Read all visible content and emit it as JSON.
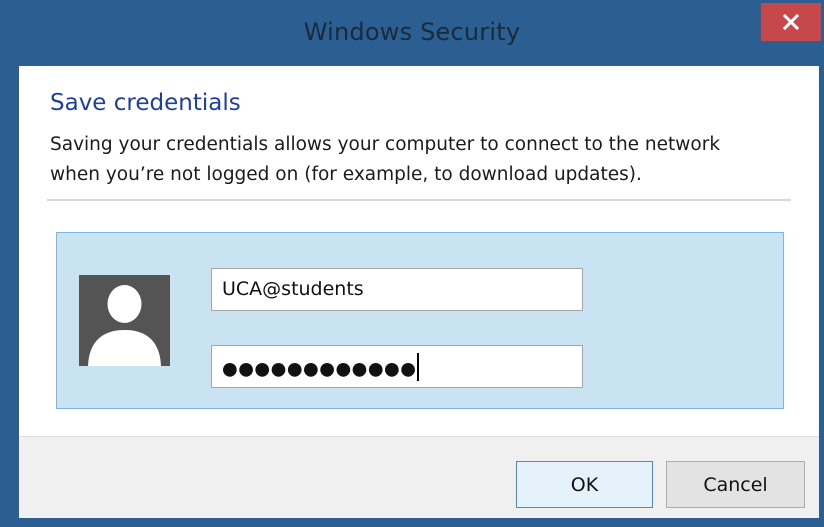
{
  "window": {
    "title": "Windows Security",
    "close_icon": "close-icon"
  },
  "dialog": {
    "heading": "Save credentials",
    "description_lines": [
      "Saving your credentials allows your computer to connect to the network",
      "when you’re not logged on (for example, to download updates)."
    ]
  },
  "credentials": {
    "avatar_icon": "user-avatar-icon",
    "username_value": "UCA@students",
    "password_masked": "●●●●●●●●●●●●"
  },
  "buttons": {
    "ok_label": "OK",
    "cancel_label": "Cancel"
  },
  "colors": {
    "titlebar": "#2b5f91",
    "close_button": "#c7484a",
    "heading": "#1e3f9b",
    "credential_panel": "#c9e3f3",
    "credential_panel_border": "#7bb6dc",
    "ok_button_border": "#3c8fd6"
  }
}
